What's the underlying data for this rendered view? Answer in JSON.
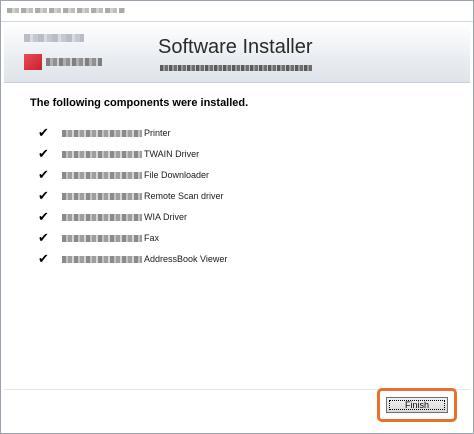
{
  "window": {
    "title": "",
    "banner_title": "Software Installer"
  },
  "content": {
    "heading": "The following components were installed.",
    "check_icon": "check-icon",
    "items": [
      {
        "label": "Printer"
      },
      {
        "label": "TWAIN Driver"
      },
      {
        "label": "File Downloader"
      },
      {
        "label": "Remote Scan driver"
      },
      {
        "label": "WIA Driver"
      },
      {
        "label": "Fax"
      },
      {
        "label": "AddressBook Viewer"
      }
    ]
  },
  "footer": {
    "finish_label": "Finish",
    "highlight_color": "#e8702a"
  }
}
